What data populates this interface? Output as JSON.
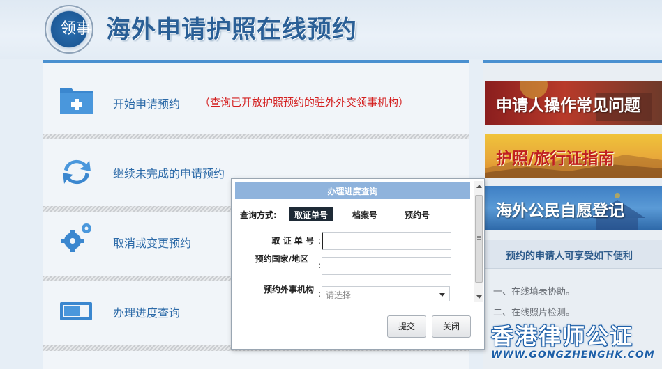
{
  "header": {
    "title": "海外申请护照在线预约",
    "emblem_text": "领事"
  },
  "menu": {
    "start": {
      "label": "开始申请预约",
      "link": "（查询已开放护照预约的驻外外交领事机构）"
    },
    "continue": {
      "label": "继续未完成的申请预约"
    },
    "cancel": {
      "label": "取消或变更预约"
    },
    "progress": {
      "label": "办理进度查询"
    }
  },
  "sidebar": {
    "banners": [
      "申请人操作常见问题",
      "护照/旅行证指南",
      "海外公民自愿登记"
    ],
    "benefits_title": "预约的申请人可享受如下便利",
    "benefits": [
      "一、在线填表协助。",
      "二、在线照片检测。"
    ]
  },
  "dialog": {
    "title": "办理进度查询",
    "query_label": "查询方式:",
    "tabs": [
      "取证单号",
      "档案号",
      "预约号"
    ],
    "active_tab": 0,
    "fields": {
      "receipt_label": "取 证 单 号",
      "country_label": "预约国家/地区",
      "mission_label": "预约外事机构",
      "colon": ":",
      "mission_placeholder": "请选择"
    },
    "buttons": {
      "submit": "提交",
      "close": "关闭"
    }
  },
  "watermark": {
    "text": "香港律师公证",
    "url": "WWW.GONGZHENGHK.COM"
  },
  "colors": {
    "accent": "#4a90d0",
    "title": "#2a5f96",
    "link_red": "#d42020"
  }
}
